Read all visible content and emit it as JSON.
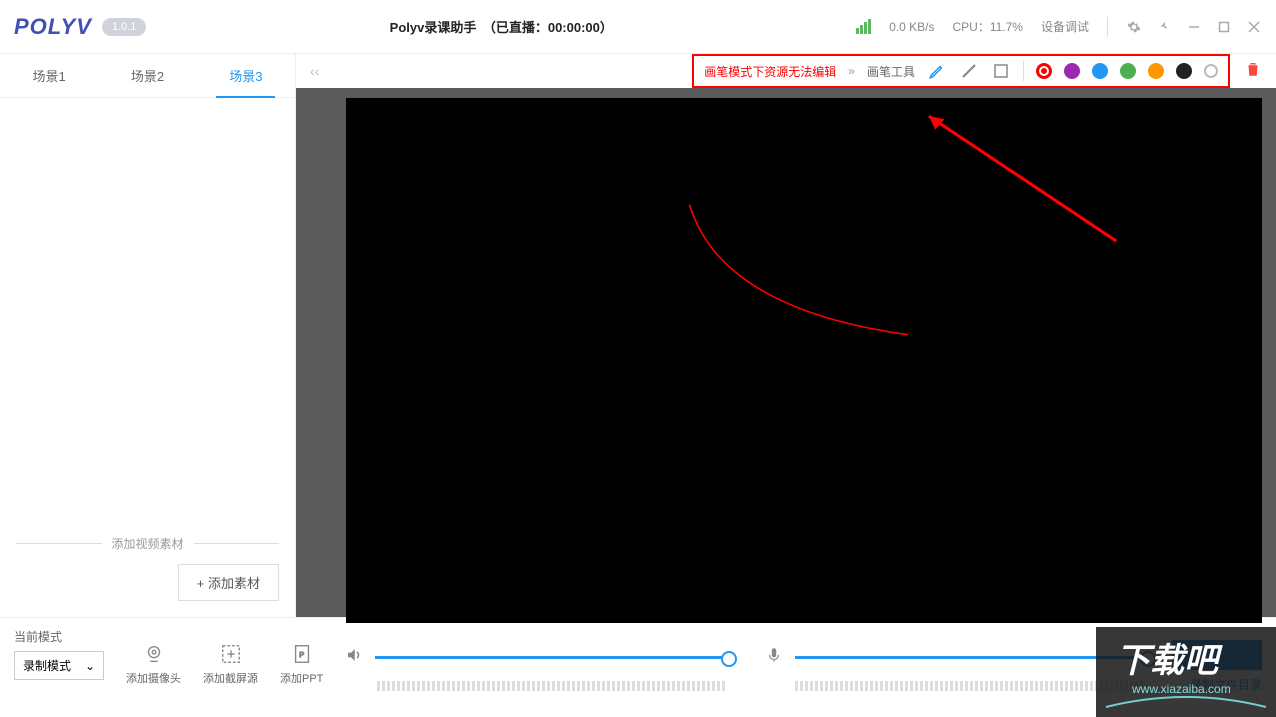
{
  "titlebar": {
    "logo": "POLYV",
    "version": "1.0.1",
    "title": "Polyv录课助手　（已直播：00:00:00）",
    "speed": "0.0 KB/s",
    "cpu": "CPU：11.7%",
    "debug": "设备调试"
  },
  "sidebar": {
    "tabs": [
      {
        "label": "场景1",
        "active": false
      },
      {
        "label": "场景2",
        "active": false
      },
      {
        "label": "场景3",
        "active": true
      }
    ],
    "divider_label": "添加视频素材",
    "add_button": "+ 添加素材"
  },
  "toolbar": {
    "brush_msg": "画笔模式下资源无法编辑",
    "arrow": "»",
    "brush_label": "画笔工具",
    "colors": [
      {
        "name": "red-ring",
        "value": "#ff0000",
        "ring": true
      },
      {
        "name": "purple",
        "value": "#9c27b0"
      },
      {
        "name": "blue",
        "value": "#2196f3"
      },
      {
        "name": "green",
        "value": "#4caf50"
      },
      {
        "name": "orange",
        "value": "#ff9800"
      },
      {
        "name": "black",
        "value": "#222"
      },
      {
        "name": "gray-ring",
        "value": "#bbb",
        "ring": true
      }
    ]
  },
  "bottom": {
    "mode_label": "当前模式",
    "mode_value": "录制模式",
    "add_camera": "添加摄像头",
    "add_screen": "添加截屏源",
    "add_ppt": "添加PPT",
    "rec_link": "录制文件目录"
  }
}
